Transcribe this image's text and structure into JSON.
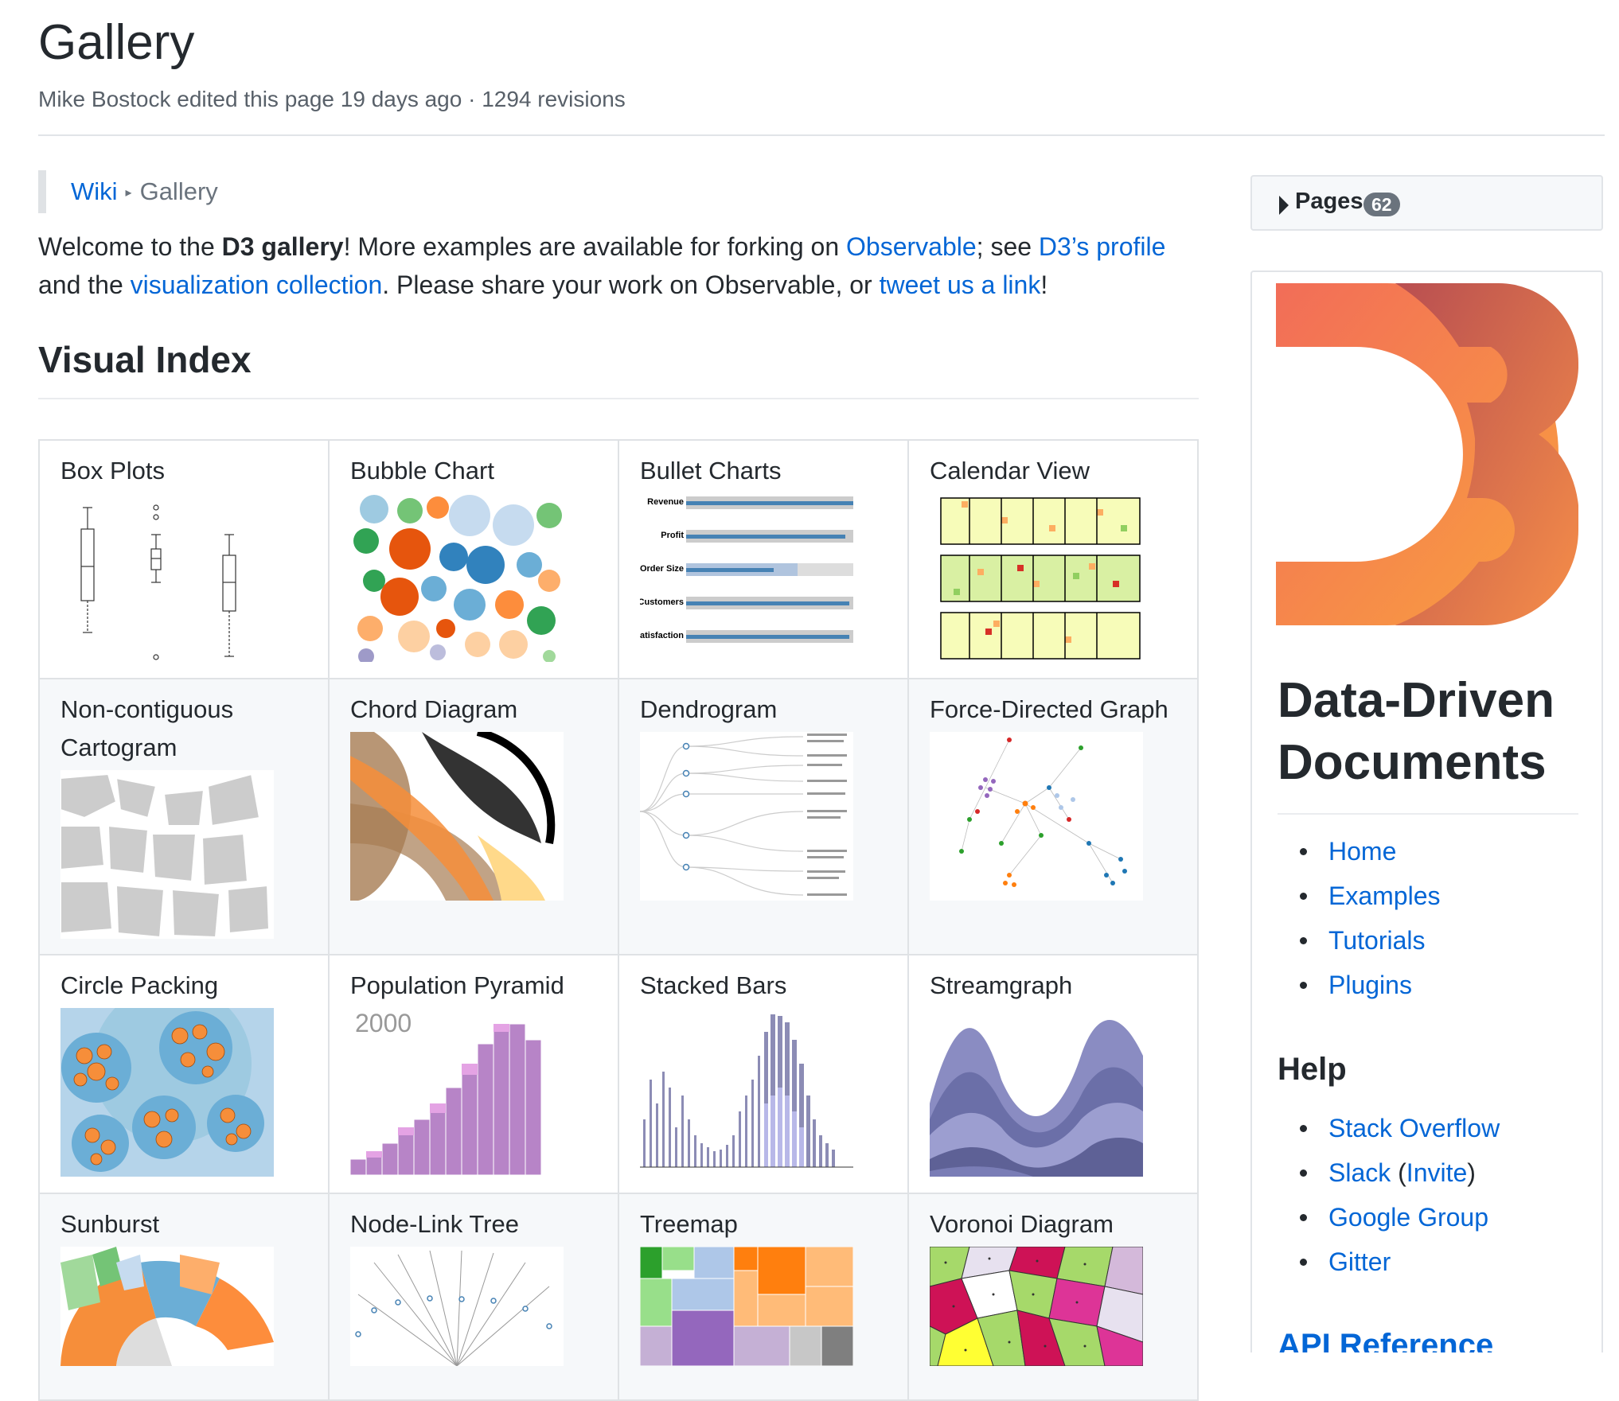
{
  "header": {
    "title": "Gallery",
    "meta": "Mike Bostock edited this page 19 days ago · 1294 revisions"
  },
  "breadcrumb": {
    "home": "Wiki",
    "separator": "▸",
    "current": "Gallery"
  },
  "intro": {
    "p1": "Welcome to the ",
    "bold": "D3 gallery",
    "p2": "! More examples are available for forking on ",
    "link_observable": "Observable",
    "p3": "; see ",
    "link_profile": "D3’s profile",
    "p4": " and the ",
    "link_collection": "visualization collection",
    "p5": ". Please share your work on Observable, or ",
    "link_tweet": "tweet us a link",
    "p6": "!"
  },
  "visual_index": {
    "heading": "Visual Index",
    "cells": [
      "Box Plots",
      "Bubble Chart",
      "Bullet Charts",
      "Calendar View",
      "Non-contiguous Cartogram",
      "Chord Diagram",
      "Dendrogram",
      "Force-Directed Graph",
      "Circle Packing",
      "Population Pyramid",
      "Stacked Bars",
      "Streamgraph",
      "Sunburst",
      "Node-Link Tree",
      "Treemap",
      "Voronoi Diagram"
    ],
    "thumb_text": {
      "pyramid_year": "2000",
      "bullet_labels": [
        "Revenue",
        "Profit",
        "Order Size",
        "Customers",
        "Satisfaction"
      ]
    }
  },
  "sidebar": {
    "pages_label": "Pages",
    "pages_count": "62",
    "brand": "Data-Driven Documents",
    "links": [
      "Home",
      "Examples",
      "Tutorials",
      "Plugins"
    ],
    "help_heading": "Help",
    "help_links": {
      "stackoverflow": "Stack Overflow",
      "slack": "Slack",
      "invite_open": " (",
      "invite": "Invite",
      "invite_close": ")",
      "google_group": "Google Group",
      "gitter": "Gitter"
    },
    "api_heading": "API Reference"
  },
  "colors": {
    "link": "#0366d6",
    "text": "#24292e",
    "muted": "#586069",
    "d3_orange": "#f68e3a",
    "d3_red": "#c9524a"
  }
}
